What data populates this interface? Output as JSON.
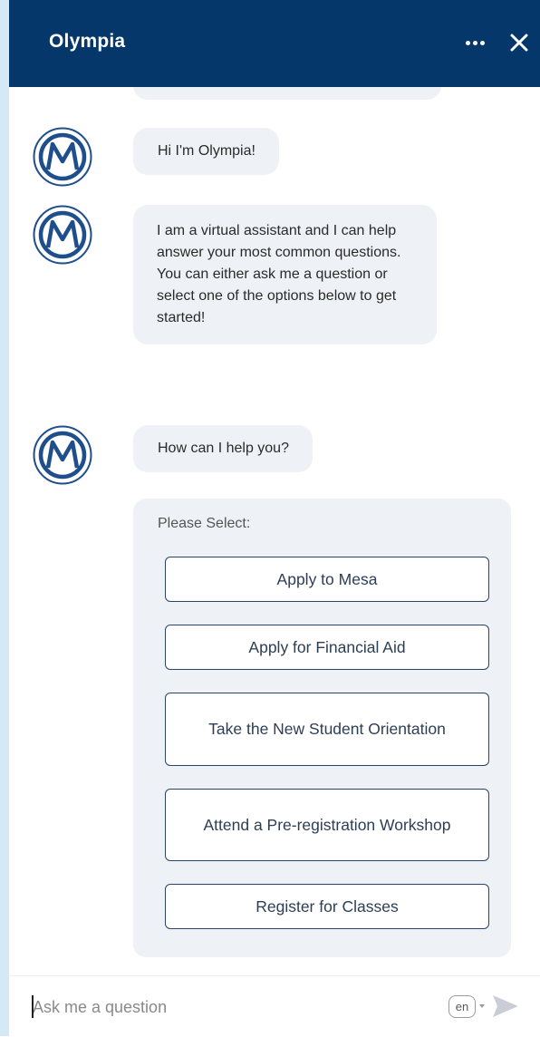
{
  "header": {
    "title": "Olympia",
    "more_icon": "ellipsis-icon",
    "close_icon": "close-icon",
    "bg_color": "#05376b"
  },
  "messages": [
    {
      "avatar_icon": "mesa-m-logo-icon",
      "text": "Hi I'm Olympia!"
    },
    {
      "avatar_icon": "mesa-m-logo-icon",
      "text": "I am a virtual assistant and I can help answer your most common questions. You can either ask me a question or select one of the options below to get started!"
    },
    {
      "avatar_icon": "mesa-m-logo-icon",
      "text": "How can I help you?"
    }
  ],
  "options": {
    "label": "Please Select:",
    "buttons": [
      {
        "label": "Apply to Mesa"
      },
      {
        "label": "Apply for Financial Aid"
      },
      {
        "label": "Take the New Student Orientation"
      },
      {
        "label": "Attend a Pre-registration Workshop"
      },
      {
        "label": "Register for Classes"
      }
    ]
  },
  "input": {
    "placeholder": "Ask me a question",
    "value": "",
    "language": "en",
    "send_icon": "send-arrow-icon"
  }
}
